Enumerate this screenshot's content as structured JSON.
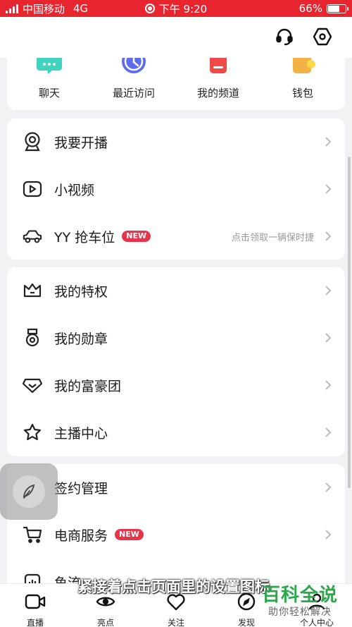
{
  "status_bar": {
    "carrier": "中国移动",
    "network": "4G",
    "time": "下午 9:20",
    "battery": "66%",
    "battery_level": 0.66
  },
  "header": {
    "support_icon": "headset-icon",
    "settings_icon": "hexagon-settings-icon"
  },
  "shortcuts": [
    {
      "label": "聊天",
      "icon": "chat-bubble-icon",
      "color": "#3fd3c0"
    },
    {
      "label": "最近访问",
      "icon": "clock-icon",
      "color": "#5b6cf0"
    },
    {
      "label": "我的频道",
      "icon": "channel-icon",
      "color": "#f04a48"
    },
    {
      "label": "钱包",
      "icon": "wallet-icon",
      "color": "#f4b144"
    }
  ],
  "group1": [
    {
      "label": "我要开播",
      "icon": "webcam-icon"
    },
    {
      "label": "小视频",
      "icon": "play-video-icon"
    },
    {
      "label": "YY 抢车位",
      "icon": "car-icon",
      "badge": "NEW",
      "hint": "点击领取一辆保时捷"
    }
  ],
  "group2": [
    {
      "label": "我的特权",
      "icon": "crown-icon"
    },
    {
      "label": "我的勋章",
      "icon": "medal-icon"
    },
    {
      "label": "我的富豪团",
      "icon": "diamond-icon"
    },
    {
      "label": "主播中心",
      "icon": "star-icon"
    }
  ],
  "group3": [
    {
      "label": "签约管理",
      "icon": "sign-icon"
    },
    {
      "label": "电商服务",
      "icon": "cart-icon",
      "badge": "NEW"
    },
    {
      "label": "鱼流",
      "icon": "chart-icon"
    }
  ],
  "subtitle": "紧接着点击页面里的设置图标",
  "tabbar": [
    {
      "label": "直播",
      "icon": "video-camera-icon"
    },
    {
      "label": "亮点",
      "icon": "eye-icon"
    },
    {
      "label": "关注",
      "icon": "heart-icon"
    },
    {
      "label": "发现",
      "icon": "compass-icon"
    },
    {
      "label": "个人中心",
      "icon": "person-icon"
    }
  ],
  "watermark": {
    "title": "百科全说",
    "slogan": "助你轻松解决"
  },
  "colors": {
    "status_bar": "#e8242f",
    "badge": "#e8344a",
    "watermark": "#2aa84a"
  }
}
